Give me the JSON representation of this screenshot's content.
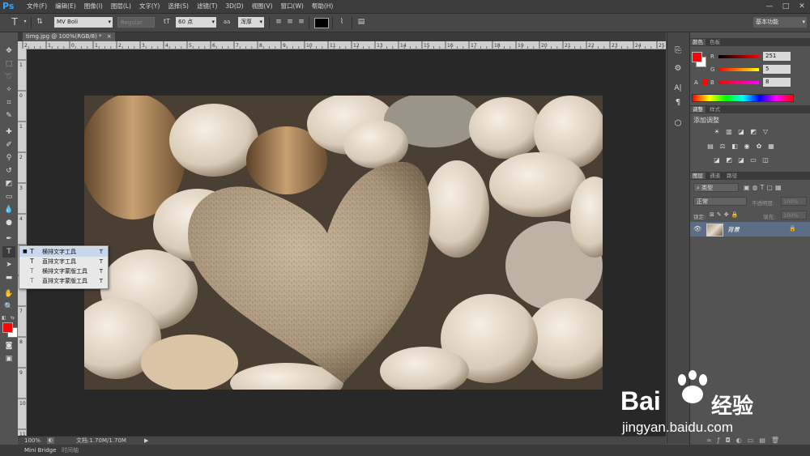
{
  "app": {
    "logo": "Ps"
  },
  "menu": [
    "文件(F)",
    "编辑(E)",
    "图像(I)",
    "图层(L)",
    "文字(Y)",
    "选择(S)",
    "滤镜(T)",
    "3D(D)",
    "视图(V)",
    "窗口(W)",
    "帮助(H)"
  ],
  "window_controls": [
    "—",
    "□",
    "✕"
  ],
  "options": {
    "font_family": "MV Boli",
    "font_style": "Regular",
    "font_size": "60 点",
    "antialias": "浑厚",
    "workspace": "基本功能",
    "color_swatch": "#000000"
  },
  "document": {
    "tab_label": "timg.jpg @ 100%(RGB/8) *",
    "close": "×"
  },
  "rulers": {
    "top_ticks": [
      "2",
      "1",
      "0",
      "1",
      "2",
      "3",
      "4",
      "5",
      "6",
      "7",
      "8",
      "9",
      "10",
      "11",
      "12",
      "13",
      "14",
      "15",
      "16",
      "17",
      "18",
      "19",
      "20",
      "21",
      "22",
      "23",
      "24",
      "25"
    ],
    "left_ticks": [
      "1",
      "0",
      "1",
      "2",
      "3",
      "4",
      "5",
      "6",
      "7",
      "8",
      "9",
      "10",
      "11",
      "12"
    ]
  },
  "status": {
    "zoom": "100%",
    "doc_info": "文档:1.70M/1.70M"
  },
  "bottom_tabs": [
    "Mini Bridge",
    "时间轴"
  ],
  "flyout": {
    "items": [
      {
        "label": "横排文字工具",
        "shortcut": "T",
        "active": true
      },
      {
        "label": "直排文字工具",
        "shortcut": "T",
        "active": false
      },
      {
        "label": "横排文字蒙版工具",
        "shortcut": "T",
        "active": false
      },
      {
        "label": "直排文字蒙版工具",
        "shortcut": "T",
        "active": false
      }
    ]
  },
  "color_panel": {
    "tabs": [
      "颜色",
      "色板"
    ],
    "channels": [
      {
        "name": "R",
        "value": "251"
      },
      {
        "name": "G",
        "value": "5"
      },
      {
        "name": "B",
        "value": "8"
      }
    ],
    "foreground": "#fb0508",
    "background": "#ffffff"
  },
  "adjust_panel": {
    "tabs": [
      "调整",
      "样式"
    ],
    "title": "添加调整"
  },
  "layers_panel": {
    "tabs": [
      "图层",
      "通道",
      "路径"
    ],
    "filter_label": "类型",
    "blend_mode": "正常",
    "opacity_label": "不透明度:",
    "opacity_value": "100%",
    "lock_label": "锁定:",
    "fill_label": "填充:",
    "fill_value": "100%",
    "layer_name": "背景"
  },
  "watermark": {
    "brand": "Bai",
    "brand2": "经验",
    "url": "jingyan.baidu.com"
  }
}
